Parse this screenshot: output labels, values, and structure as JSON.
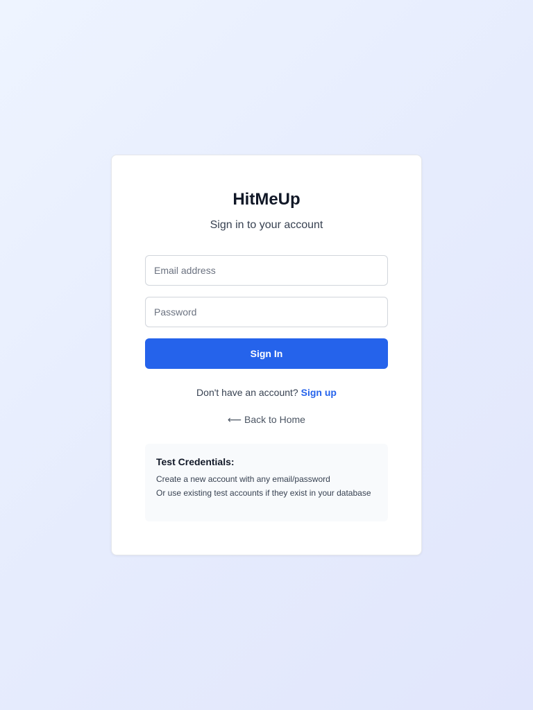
{
  "app": {
    "title": "HitMeUp",
    "subtitle": "Sign in to your account"
  },
  "form": {
    "email_placeholder": "Email address",
    "email_value": "",
    "password_placeholder": "Password",
    "password_value": "",
    "submit_label": "Sign In"
  },
  "signup": {
    "prompt": "Don't have an account?",
    "link_label": "Sign up"
  },
  "back": {
    "arrow_icon": "⟵",
    "label": "Back to Home"
  },
  "test_credentials": {
    "title": "Test Credentials:",
    "lines": [
      "Create a new account with any email/password",
      "Or use existing test accounts if they exist in your database"
    ]
  },
  "colors": {
    "accent": "#2563eb",
    "title": "#111827",
    "muted": "#4b5563",
    "card": "#ffffff",
    "info_box": "#f8fafc"
  }
}
